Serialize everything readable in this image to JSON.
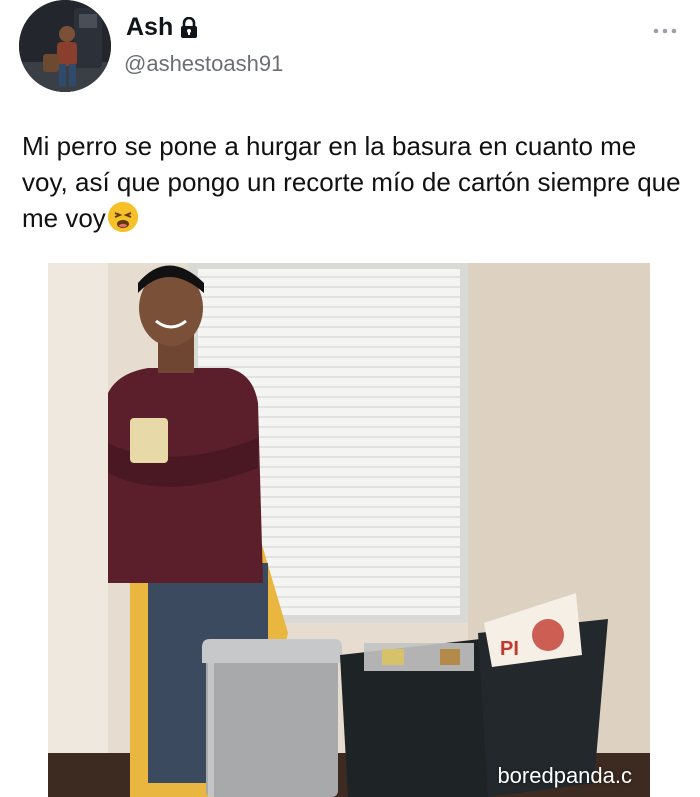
{
  "user": {
    "display_name": "Ash",
    "handle": "@ashestoash91",
    "lock_icon": "lock-icon"
  },
  "menu": {
    "label": "•••",
    "icon": "more-icon"
  },
  "tweet": {
    "text": "Mi perro se pone a hurgar en la basura en cuanto me voy, así que pongo un recorte mío de cartón siempre que me voy",
    "emoji": "tired-face-emoji"
  },
  "photo": {
    "watermark": "boredpanda.c",
    "trash_box_text": "PI"
  },
  "colors": {
    "handle": "#6b6f74",
    "wall": "#e8ddd0",
    "sweater": "#5a1f2a",
    "bin_black": "#1e2326",
    "bin_steel": "#a7a9ab"
  }
}
